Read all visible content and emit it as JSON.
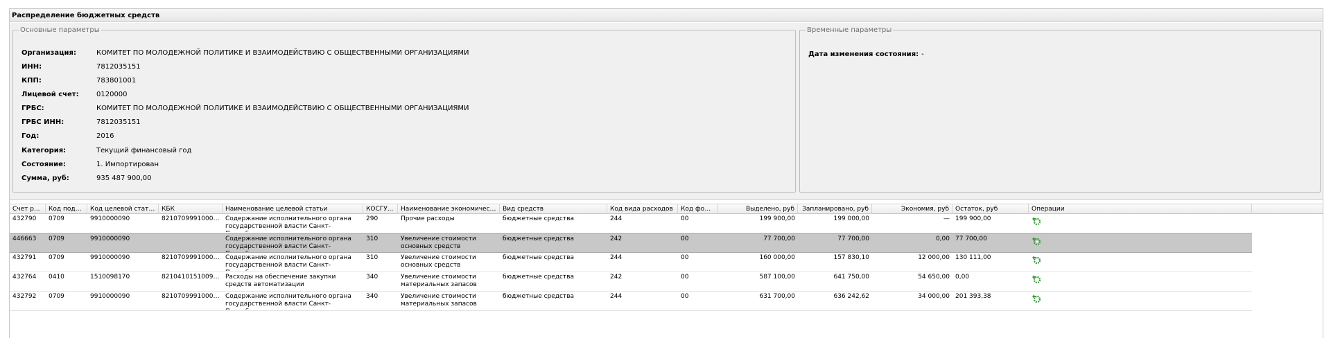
{
  "panel": {
    "title": "Распределение бюджетных средств"
  },
  "main_params": {
    "legend": "Основные параметры",
    "fields": [
      {
        "label": "Организация:",
        "value": "КОМИТЕТ ПО МОЛОДЕЖНОЙ ПОЛИТИКЕ И ВЗАИМОДЕЙСТВИЮ С ОБЩЕСТВЕННЫМИ ОРГАНИЗАЦИЯМИ"
      },
      {
        "label": "ИНН:",
        "value": "7812035151"
      },
      {
        "label": "КПП:",
        "value": "783801001"
      },
      {
        "label": "Лицевой счет:",
        "value": "0120000"
      },
      {
        "label": "ГРБС:",
        "value": "КОМИТЕТ ПО МОЛОДЕЖНОЙ ПОЛИТИКЕ И ВЗАИМОДЕЙСТВИЮ С ОБЩЕСТВЕННЫМИ ОРГАНИЗАЦИЯМИ"
      },
      {
        "label": "ГРБС ИНН:",
        "value": "7812035151"
      },
      {
        "label": "Год:",
        "value": "2016"
      },
      {
        "label": "Категория:",
        "value": "Текущий финансовый год"
      },
      {
        "label": "Состояние:",
        "value": "1. Импортирован"
      },
      {
        "label": "Сумма, руб:",
        "value": "935 487 900,00"
      }
    ]
  },
  "temp_params": {
    "legend": "Временные параметры",
    "change_date_label": "Дата изменения состояния:",
    "change_date_value": "-"
  },
  "grid": {
    "columns": [
      "Счет р...",
      "Код подра...",
      "Код целевой статьи",
      "КБК",
      "Наименование целевой статьи",
      "КОСГУ...",
      "Наименование экономической ...",
      "Вид средств",
      "Код вида расходов",
      "Код фонда",
      "Выделено, руб",
      "Запланировано, руб",
      "Экономия, руб",
      "Остаток, руб",
      "Операции"
    ],
    "rows": [
      {
        "account": "432790",
        "dept": "0709",
        "target_code": "9910000090",
        "kbk": "82107099910000...",
        "target_name": "Содержание исполнительного органа государственной власти Санкт-Петербурга",
        "kosgu": "290",
        "econ_name": "Прочие расходы",
        "funds_type": "бюджетные средства",
        "expense_code": "244",
        "fund_code": "00",
        "allocated": "199 900,00",
        "planned": "199 000,00",
        "savings": "—",
        "remainder": "199 900,00",
        "selected": false
      },
      {
        "account": "446663",
        "dept": "0709",
        "target_code": "9910000090",
        "kbk": "",
        "target_name": "Содержание исполнительного органа государственной власти Санкт-Петербурга",
        "kosgu": "310",
        "econ_name": "Увеличение стоимости основных средств",
        "funds_type": "бюджетные средства",
        "expense_code": "242",
        "fund_code": "00",
        "allocated": "77 700,00",
        "planned": "77 700,00",
        "savings": "0,00",
        "remainder": "77 700,00",
        "selected": true
      },
      {
        "account": "432791",
        "dept": "0709",
        "target_code": "9910000090",
        "kbk": "82107099910000...",
        "target_name": "Содержание исполнительного органа государственной власти Санкт-Петербурга",
        "kosgu": "310",
        "econ_name": "Увеличение стоимости основных средств",
        "funds_type": "бюджетные средства",
        "expense_code": "244",
        "fund_code": "00",
        "allocated": "160 000,00",
        "planned": "157 830,10",
        "savings": "12 000,00",
        "remainder": "130 111,00",
        "selected": false
      },
      {
        "account": "432764",
        "dept": "0410",
        "target_code": "1510098170",
        "kbk": "82104101510098...",
        "target_name": "Расходы на обеспечение закупки средств автоматизации",
        "kosgu": "340",
        "econ_name": "Увеличение стоимости материальных запасов",
        "funds_type": "бюджетные средства",
        "expense_code": "242",
        "fund_code": "00",
        "allocated": "587 100,00",
        "planned": "641 750,00",
        "savings": "54 650,00",
        "remainder": "0,00",
        "selected": false
      },
      {
        "account": "432792",
        "dept": "0709",
        "target_code": "9910000090",
        "kbk": "82107099910000...",
        "target_name": "Содержание исполнительного органа государственной власти Санкт-Петербурга",
        "kosgu": "340",
        "econ_name": "Увеличение стоимости материальных запасов",
        "funds_type": "бюджетные средства",
        "expense_code": "244",
        "fund_code": "00",
        "allocated": "631 700,00",
        "planned": "636 242,62",
        "savings": "34 000,00",
        "remainder": "201 393,38",
        "selected": false
      }
    ],
    "op_icon": "refresh-gear-icon",
    "colors": {
      "selected_row": "#c8c8c8",
      "icon_green": "#3a9a3a"
    }
  }
}
